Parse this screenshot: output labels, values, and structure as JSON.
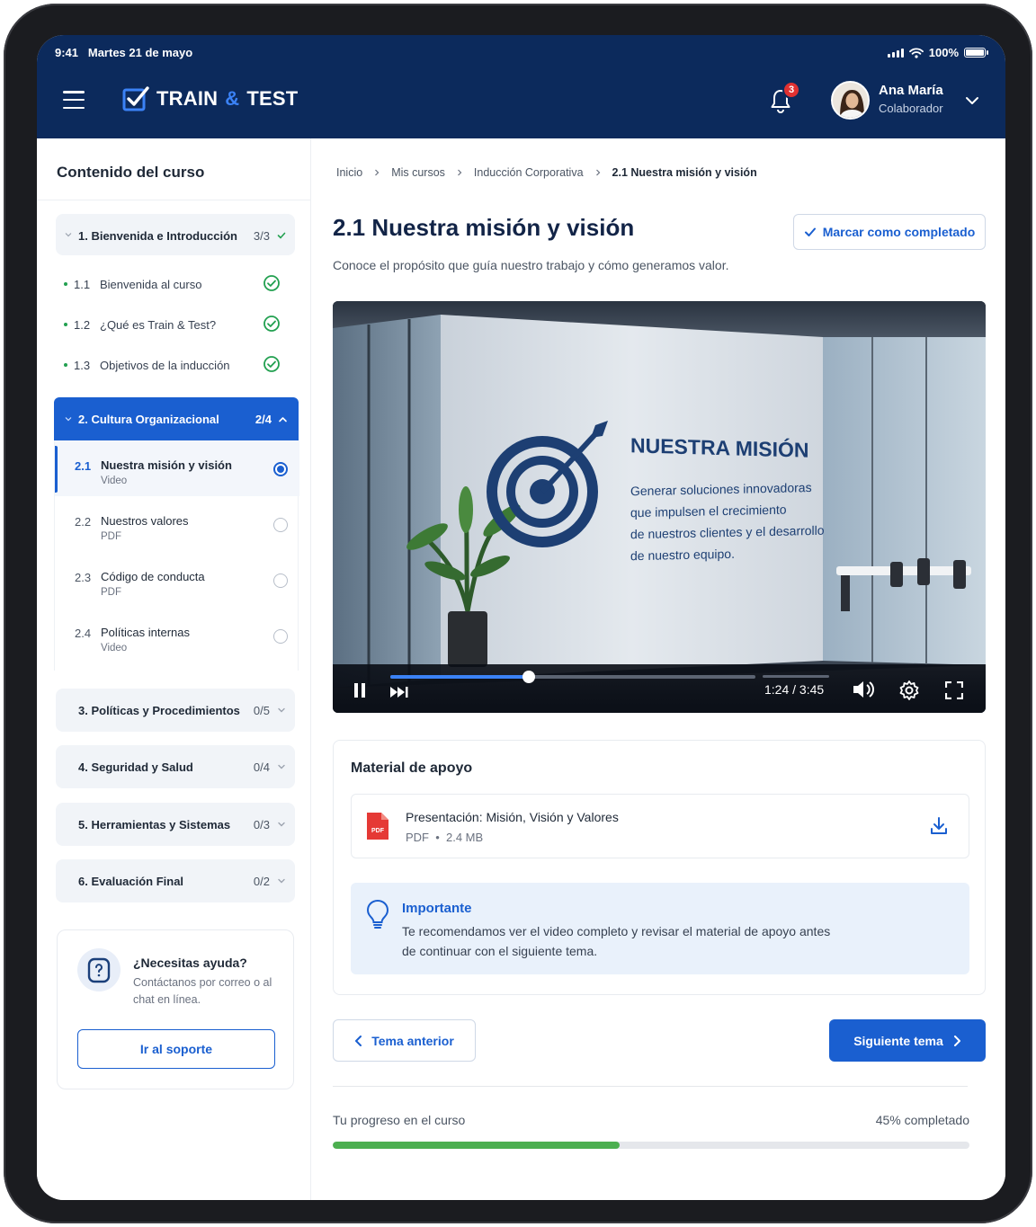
{
  "status": {
    "time": "9:41",
    "date": "Martes 21 de mayo",
    "battery": "100%"
  },
  "header": {
    "brand_a": "TRAIN",
    "brand_amp": "&",
    "brand_b": "TEST",
    "notifications": "3",
    "user_name": "Ana María",
    "user_role": "Colaborador"
  },
  "sidebar": {
    "title": "Contenido del curso",
    "modules": [
      {
        "label": "1. Bienvenida e Introducción",
        "count": "3/3",
        "lessons": [
          {
            "num": "1.1",
            "title": "Bienvenida al curso"
          },
          {
            "num": "1.2",
            "title": "¿Qué es Train & Test?"
          },
          {
            "num": "1.3",
            "title": "Objetivos de la inducción"
          }
        ]
      },
      {
        "label": "2. Cultura Organizacional",
        "count": "2/4",
        "lessons": [
          {
            "num": "2.1",
            "title": "Nuestra misión y visión",
            "type": "Video"
          },
          {
            "num": "2.2",
            "title": "Nuestros valores",
            "type": "PDF"
          },
          {
            "num": "2.3",
            "title": "Código de conducta",
            "type": "PDF"
          },
          {
            "num": "2.4",
            "title": "Políticas internas",
            "type": "Video"
          }
        ]
      },
      {
        "label": "3. Políticas y Procedimientos",
        "count": "0/5"
      },
      {
        "label": "4. Seguridad y Salud",
        "count": "0/4"
      },
      {
        "label": "5. Herramientas y Sistemas",
        "count": "0/3"
      },
      {
        "label": "6. Evaluación Final",
        "count": "0/2"
      }
    ],
    "help": {
      "title": "¿Necesitas ayuda?",
      "text": "Contáctanos por correo o al chat en línea.",
      "button": "Ir al soporte"
    }
  },
  "breadcrumb": [
    "Inicio",
    "Mis cursos",
    "Inducción Corporativa",
    "2.1 Nuestra misión y visión"
  ],
  "lesson": {
    "title": "2.1 Nuestra misión y visión",
    "subtitle": "Conoce el propósito que guía nuestro trabajo y cómo generamos valor.",
    "complete_button": "Marcar como completado"
  },
  "video": {
    "heading": "NUESTRA MISIÓN",
    "lines": [
      "Generar soluciones innovadoras",
      "que impulsen el crecimiento",
      "de nuestros clientes y el desarrollo",
      "de nuestro equipo."
    ],
    "time": "1:24 / 3:45",
    "progress": 0.38
  },
  "material": {
    "title": "Material de apoyo",
    "file_name": "Presentación: Misión, Visión y Valores",
    "file_type": "PDF",
    "file_size": "2.4 MB",
    "pdf_label": "PDF",
    "note_title": "Importante",
    "note_text": "Te recomendamos ver el video completo y revisar el material de apoyo antes de continuar con el siguiente tema."
  },
  "nav": {
    "prev": "Tema anterior",
    "next": "Siguiente tema"
  },
  "course_progress": {
    "label": "Tu progreso en el curso",
    "value_text": "45% completado",
    "value": 0.45
  },
  "colors": {
    "brand_navy": "#0c2a5c",
    "accent_blue": "#1a5fd0",
    "success_green": "#22a050",
    "progress_green": "#4caf50",
    "badge_red": "#e03131"
  }
}
